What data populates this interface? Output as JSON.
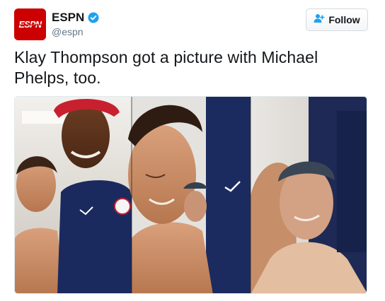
{
  "account": {
    "name": "ESPN",
    "handle": "@espn",
    "avatar_text": "ESPN",
    "verified": true
  },
  "follow_button": {
    "label": "Follow",
    "icon": "add-user-icon"
  },
  "tweet": {
    "text": "Klay Thompson got a picture with Michael Phelps, too."
  },
  "colors": {
    "brand_red": "#cc0000",
    "verified_blue": "#1da1f2",
    "text_primary": "#14171a",
    "text_secondary": "#657786"
  }
}
